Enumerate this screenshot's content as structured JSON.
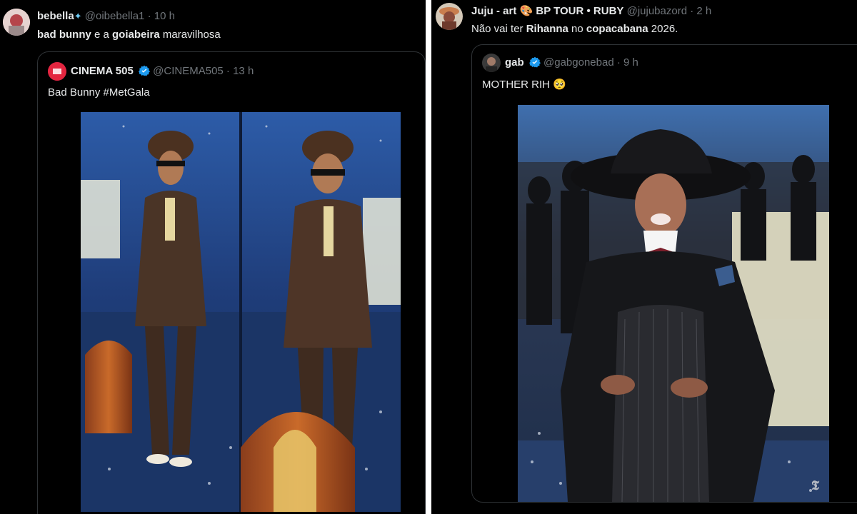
{
  "left_tweet": {
    "author_name": "bebella",
    "handle": "@oibebella1",
    "time": "10 h",
    "text_parts": [
      "bad bunny",
      " e a ",
      "goiabeira",
      " maravilhosa"
    ],
    "quote": {
      "author_name": "CINEMA 505",
      "handle": "@CINEMA505",
      "time": "13 h",
      "text": "Bad Bunny #MetGala"
    }
  },
  "right_tweet": {
    "author_name": "Juju - art",
    "author_name_suffix": "BP TOUR • RUBY",
    "handle": "@jujubazord",
    "time": "2 h",
    "text_parts": [
      "Não vai ter ",
      "Rihanna",
      " no ",
      "copacabana",
      " 2026."
    ],
    "quote": {
      "author_name": "gab",
      "handle": "@gabgonebad",
      "time": "9 h",
      "text": "MOTHER RIH",
      "emoji": "🥺"
    }
  },
  "colors": {
    "background": "#000000",
    "text": "#e7e9ea",
    "muted": "#71767b",
    "border": "#2f3336",
    "verified": "#1d9bf0"
  }
}
